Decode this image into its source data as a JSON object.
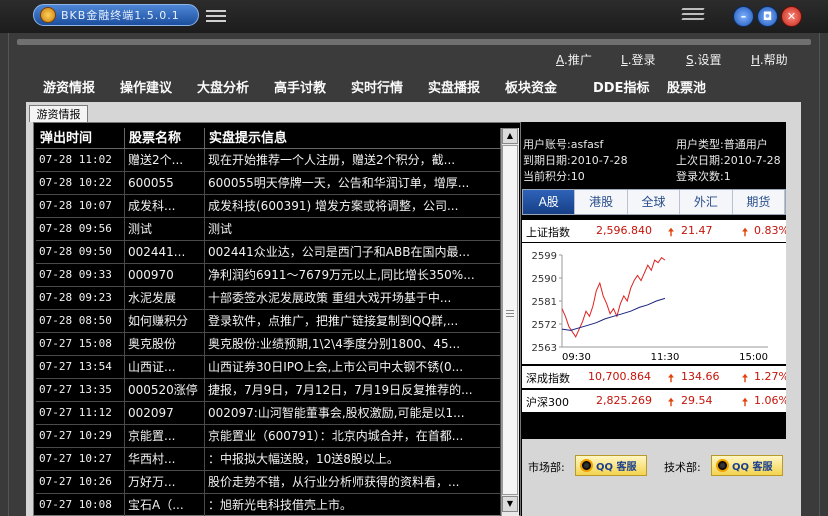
{
  "window": {
    "title": "BKB金融终端1.5.0.1",
    "controls": {
      "min": "–",
      "max": "◘",
      "close": "✕"
    }
  },
  "toplinks": [
    {
      "key": "A",
      "label": ".推广"
    },
    {
      "key": "L",
      "label": ".登录"
    },
    {
      "key": "S",
      "label": ".设置"
    },
    {
      "key": "H",
      "label": ".帮助"
    }
  ],
  "nav": [
    "游资情报",
    "操作建议",
    "大盘分析",
    "高手讨教",
    "实时行情",
    "实盘播报",
    "板块资金",
    "DDE指标",
    "股票池"
  ],
  "active_tab": "游资情报",
  "news_table": {
    "headers": [
      "弹出时间",
      "股票名称",
      "实盘提示信息"
    ],
    "rows": [
      [
        "07-28 11:02",
        "赠送2个...",
        "现在开始推荐一个人注册，赠送2个积分，截..."
      ],
      [
        "07-28 10:22",
        "600055",
        "600055明天停牌一天，公告和华润订单，增厚..."
      ],
      [
        "07-28 10:07",
        "成发科...",
        "成发科技(600391) 增发方案或将调整，公司..."
      ],
      [
        "07-28 09:56",
        "测试",
        "测试"
      ],
      [
        "07-28 09:50",
        "002441...",
        "002441众业达，公司是西门子和ABB在国内最..."
      ],
      [
        "07-28 09:33",
        "000970",
        "净利润约6911～7679万元以上,同比增长350%..."
      ],
      [
        "07-28 09:23",
        "水泥发展",
        "十部委签水泥发展政策 重组大戏开场基于中..."
      ],
      [
        "07-28 08:50",
        "如何赚积分",
        "登录软件，点推广，把推广链接复制到QQ群,..."
      ],
      [
        "07-27 15:08",
        "奥克股份",
        "奥克股份:业绩预期,1\\2\\4季度分别1800、45..."
      ],
      [
        "07-27 13:54",
        "山西证...",
        "山西证券30日IPO上会,上市公司中太钢不锈(0..."
      ],
      [
        "07-27 13:35",
        "000520涨停",
        "捷报，7月9日，7月12日，7月19日反复推荐的..."
      ],
      [
        "07-27 11:12",
        "002097",
        "002097:山河智能董事会,股权激励,可能是以1..."
      ],
      [
        "07-27 10:29",
        "京能置...",
        "京能置业（600791）：北京内城合并，在首都..."
      ],
      [
        "07-27 10:27",
        "华西村...",
        "：中报拟大幅送股，10送8股以上。"
      ],
      [
        "07-27 10:26",
        "万好万...",
        "股价走势不错，从行业分析师获得的资料看，..."
      ],
      [
        "07-27 10:08",
        "宝石A（...",
        "：旭新光电科技借壳上市。"
      ]
    ]
  },
  "user_info": {
    "account_label": "用户账号:",
    "account": "asfasf",
    "type_label": "用户类型:",
    "type": "普通用户",
    "expire_label": "到期日期:",
    "expire": "2010-7-28",
    "last_label": "上次日期:",
    "last": "2010-7-28",
    "points_label": "当前积分:",
    "points": "10",
    "logins_label": "登录次数:",
    "logins": "1"
  },
  "market_tabs": [
    "A股",
    "港股",
    "全球",
    "外汇",
    "期货"
  ],
  "indices": [
    {
      "name": "上证指数",
      "value": "2,596.840",
      "change": "21.47",
      "pct": "0.83%"
    },
    {
      "name": "深成指数",
      "value": "10,700.864",
      "change": "134.66",
      "pct": "1.27%"
    },
    {
      "name": "沪深300",
      "value": "2,825.269",
      "change": "29.54",
      "pct": "1.06%"
    }
  ],
  "chart_data": {
    "type": "line",
    "title": "",
    "xlabel": "",
    "ylabel": "",
    "x_ticks": [
      "09:30",
      "11:30",
      "15:00"
    ],
    "y_ticks": [
      2563,
      2572,
      2581,
      2590,
      2599
    ],
    "ylim": [
      2563,
      2599
    ],
    "x_range": [
      0,
      240
    ],
    "series": [
      {
        "color": "#e02020",
        "x": [
          0,
          4,
          8,
          12,
          16,
          20,
          24,
          28,
          32,
          36,
          40,
          44,
          48,
          52,
          56,
          60,
          64,
          68,
          72,
          76,
          80,
          84,
          88,
          92,
          96,
          100,
          104,
          108,
          112,
          116,
          120
        ],
        "y": [
          2578,
          2575,
          2571,
          2569,
          2567,
          2570,
          2573,
          2577,
          2575,
          2579,
          2585,
          2588,
          2583,
          2580,
          2576,
          2578,
          2575,
          2580,
          2583,
          2581,
          2586,
          2589,
          2591,
          2589,
          2592,
          2595,
          2593,
          2597,
          2596,
          2598,
          2597
        ]
      },
      {
        "color": "#1a237e",
        "x": [
          0,
          10,
          20,
          30,
          40,
          50,
          60,
          70,
          80,
          90,
          100,
          110,
          120
        ],
        "y": [
          2570,
          2569.5,
          2570.5,
          2571.5,
          2572.5,
          2574,
          2575,
          2576,
          2577,
          2578.5,
          2579.5,
          2581,
          2582
        ]
      }
    ]
  },
  "footer": {
    "market_label": "市场部:",
    "tech_label": "技术部:",
    "qq_text": "QQ 客服"
  }
}
